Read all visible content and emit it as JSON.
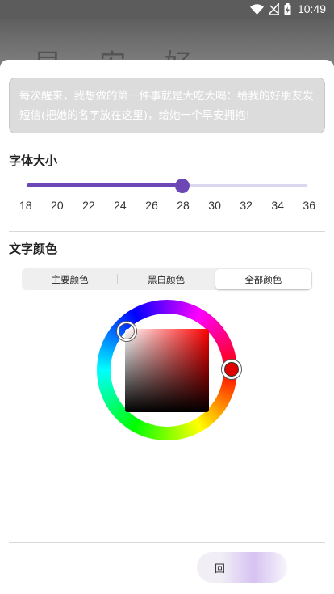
{
  "status_bar": {
    "time": "10:49",
    "icons": [
      "wifi-icon",
      "signal-off-icon",
      "battery-charging-icon"
    ]
  },
  "background": {
    "script_text": "早 安 好"
  },
  "preview_text": "每次醒来，我想做的第一件事就是大吃大喝：给我的好朋友发短信(把她的名字放在这里)，给她一个早安拥抱!",
  "font_size": {
    "title": "字体大小",
    "ticks": [
      "18",
      "20",
      "22",
      "24",
      "26",
      "28",
      "30",
      "32",
      "34",
      "36"
    ],
    "selected_value": 28,
    "min": 18,
    "max": 36
  },
  "text_color": {
    "title": "文字颜色",
    "tabs": [
      {
        "label": "主要颜色",
        "active": false
      },
      {
        "label": "黑白颜色",
        "active": false
      },
      {
        "label": "全部颜色",
        "active": true
      }
    ],
    "selected_hue_color": "#e00000"
  },
  "colors": {
    "accent": "#6c47b5",
    "track": "#dcd6ee"
  },
  "confirm": {
    "label": "回"
  }
}
